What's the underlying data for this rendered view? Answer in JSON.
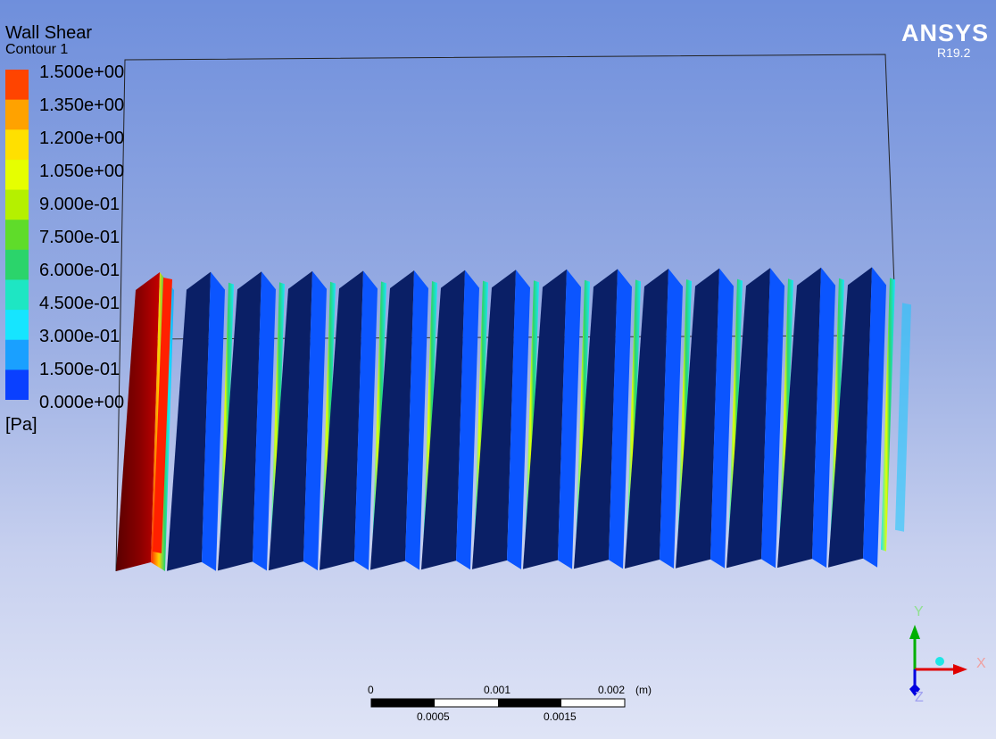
{
  "legend": {
    "title": "Wall Shear",
    "subtitle": "Contour 1",
    "labels": [
      "1.500e+00",
      "1.350e+00",
      "1.200e+00",
      "1.050e+00",
      "9.000e-01",
      "7.500e-01",
      "6.000e-01",
      "4.500e-01",
      "3.000e-01",
      "1.500e-01",
      "0.000e+00"
    ],
    "colors": [
      "#ff4400",
      "#ffa200",
      "#ffe000",
      "#e6ff00",
      "#b5f000",
      "#5fdc2a",
      "#2bd46b",
      "#1ee6c3",
      "#16e5ff",
      "#1aa0ff",
      "#0a40ff"
    ],
    "units": "[Pa]"
  },
  "brand": {
    "name": "ANSYS",
    "version": "R19.2"
  },
  "scale": {
    "top_labels": [
      "0",
      "0.001",
      "0.002",
      "(m)"
    ],
    "bottom_labels": [
      "0.0005",
      "0.0015"
    ]
  },
  "triad": {
    "x": "X",
    "y": "Y",
    "z": "Z"
  },
  "model": {
    "fold_count": 15
  }
}
